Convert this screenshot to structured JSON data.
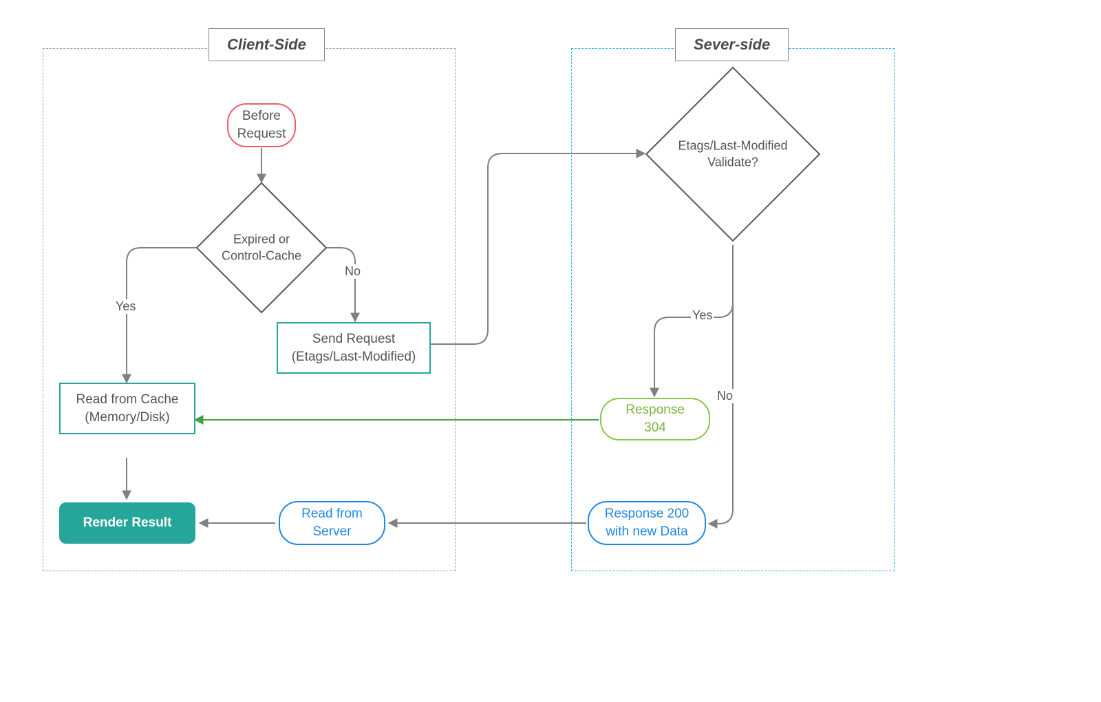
{
  "panels": {
    "client": "Client-Side",
    "server": "Sever-side"
  },
  "nodes": {
    "before_request": "Before\nRequest",
    "expired_check": "Expired or\nControl-Cache",
    "send_request": "Send Request\n(Etags/Last-Modified)",
    "read_cache": "Read from Cache\n(Memory/Disk)",
    "render_result": "Render Result",
    "read_server": "Read from\nServer",
    "validate": "Etags/Last-Modified\nValidate?",
    "resp304": "Response 304",
    "resp200": "Response 200\nwith new Data"
  },
  "edges": {
    "yes1": "Yes",
    "no1": "No",
    "yes2": "Yes",
    "no2": "No"
  },
  "colors": {
    "gray": "#808080",
    "green": "#43a047",
    "teal": "#26a69a",
    "blue": "#1E88E5",
    "lime": "#8bc34a",
    "red": "#ef5a6f",
    "cyanDash": "#29b6f6"
  }
}
